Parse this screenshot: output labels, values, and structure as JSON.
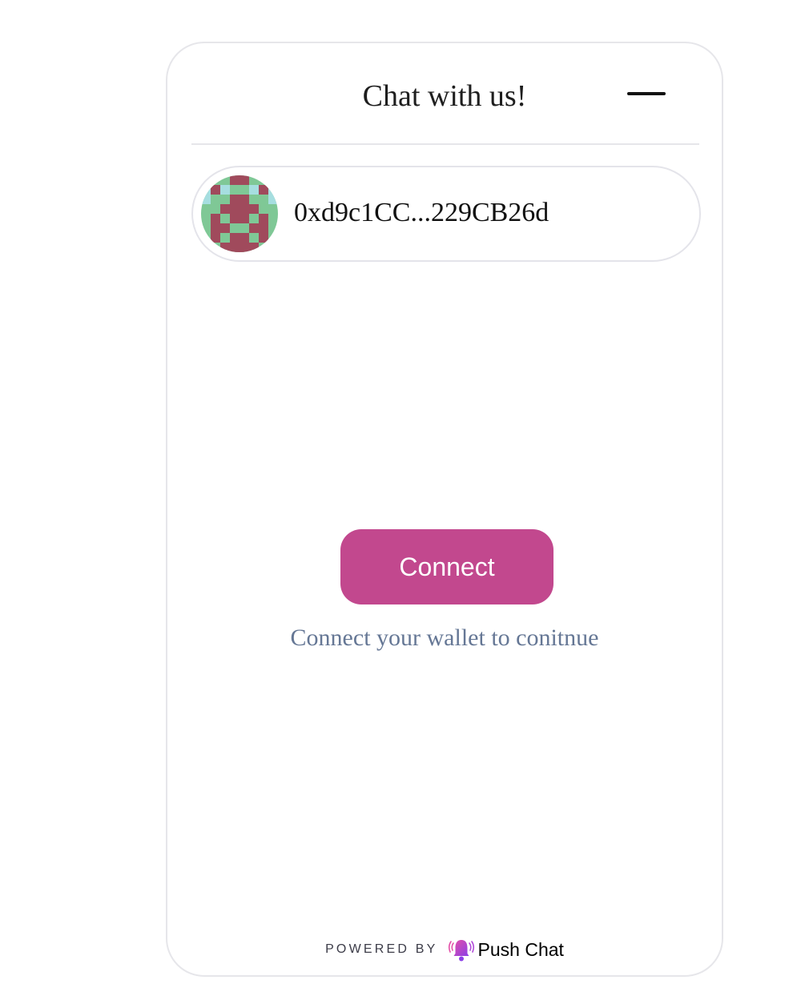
{
  "header": {
    "title": "Chat with us!",
    "minimize_icon": "minimize-icon"
  },
  "account": {
    "address": "0xd9c1CC...229CB26d",
    "avatar_icon": "blockie-avatar"
  },
  "main": {
    "connect_label": "Connect",
    "hint": "Connect your wallet to conitnue"
  },
  "footer": {
    "powered_by": "POWERED BY",
    "brand": "Push Chat",
    "logo_icon": "push-bell-icon"
  },
  "colors": {
    "accent": "#c2488e",
    "hint_text": "#657795",
    "border": "#e6e6ea",
    "avatar_green": "#7fc896",
    "avatar_red": "#a04a5c",
    "avatar_cyan": "#a6dee0"
  }
}
